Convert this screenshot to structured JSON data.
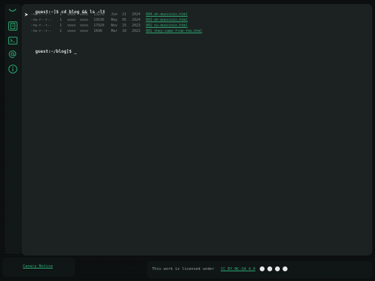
{
  "sidebar": {
    "icons": [
      {
        "name": "blog-page-icon",
        "active": true
      },
      {
        "name": "terminal-icon",
        "active": false
      },
      {
        "name": "at-contact-icon",
        "active": false
      },
      {
        "name": "info-icon",
        "active": false
      }
    ]
  },
  "terminal": {
    "command_prompt": "guest:~]$",
    "command": "cd blog && ls -lt",
    "files": [
      {
        "perms": "-rw-r--r--",
        "links": "1",
        "owner": "voxx",
        "group": "voxx",
        "size": "13270",
        "month": "Jun",
        "day": "21",
        "year": "2024",
        "name": "004_eh-muncinin.html"
      },
      {
        "perms": "-rw-r--r--",
        "links": "1",
        "owner": "voxx",
        "group": "voxx",
        "size": "19530",
        "month": "May",
        "day": "05",
        "year": "2024",
        "name": "003_eh-muncinin.html"
      },
      {
        "perms": "-rw-r--r--",
        "links": "1",
        "owner": "voxx",
        "group": "voxx",
        "size": "17920",
        "month": "Nov",
        "day": "25",
        "year": "2023",
        "name": "002_nu-muncinin.html"
      },
      {
        "perms": "-rw-r--r--",
        "links": "1",
        "owner": "voxx",
        "group": "voxx",
        "size": "1690",
        "month": "Mar",
        "day": "10",
        "year": "2022",
        "name": "001_they-came-from-the.html"
      }
    ],
    "current_prompt": "guest:~/blog]$",
    "cursor": "_"
  },
  "footer": {
    "canary_label": "Canary Notice",
    "license_text": "This work is licensed under",
    "license_link": "CC BY-NC-SA 4.0"
  },
  "colors": {
    "accent": "#2fae76",
    "background": "#0b0e0e",
    "panel": "#1c2222",
    "sidebar": "#121818"
  }
}
